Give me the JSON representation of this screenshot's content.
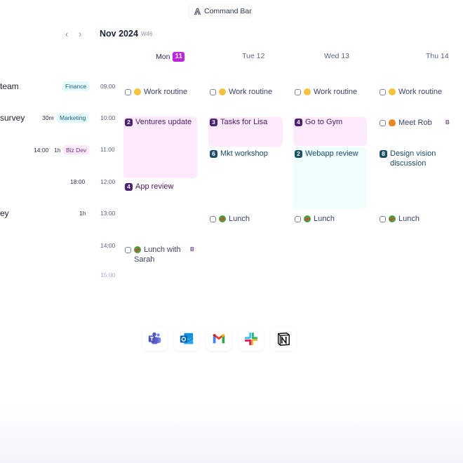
{
  "command_bar": {
    "label": "Command Bar",
    "icon": "command-icon"
  },
  "header": {
    "prev_icon": "chevron-left-icon",
    "next_icon": "chevron-right-icon",
    "prev_glyph": "‹",
    "next_glyph": "›",
    "month": "Nov 2024",
    "week": "W46",
    "days": [
      {
        "name": "Mon",
        "date": "11",
        "today": true,
        "label": "Mon"
      },
      {
        "label": "Tue 12"
      },
      {
        "label": "Wed 13"
      },
      {
        "label": "Thu 14"
      }
    ],
    "today_color": "#c122e0"
  },
  "task_list": [
    {
      "title": "team",
      "tag": "Finance"
    },
    {
      "title": "survey",
      "duration": "30m",
      "tag": "Marketing"
    },
    {
      "time": "14:00",
      "duration": "1h",
      "tag": "Biz Dev"
    },
    {
      "time": "18:00"
    },
    {
      "title": "ey",
      "duration": "1h"
    }
  ],
  "times": [
    "09:00",
    "10:00",
    "11:00",
    "12:00",
    "13:00",
    "14:00",
    "15:00"
  ],
  "events": {
    "mon": [
      {
        "title": "Work routine",
        "type": "checkable",
        "emoji": "slightly-smiling-face"
      },
      {
        "title": "Ventures update",
        "count": "2",
        "color": "purple"
      },
      {
        "title": "App review",
        "count": "4",
        "color": "purple"
      },
      {
        "title": "Lunch with",
        "title2": "Sarah",
        "type": "checkable",
        "emoji": "salad",
        "badge": "B"
      }
    ],
    "tue": [
      {
        "title": "Work routine",
        "type": "checkable",
        "emoji": "slightly-smiling-face"
      },
      {
        "title": "Tasks for Lisa",
        "count": "3",
        "color": "purple"
      },
      {
        "title": "Mkt workshop",
        "count": "6",
        "color": "teal"
      },
      {
        "title": "Lunch",
        "type": "checkable",
        "emoji": "salad"
      }
    ],
    "wed": [
      {
        "title": "Work routine",
        "type": "checkable",
        "emoji": "slightly-smiling-face"
      },
      {
        "title": "Go to Gym",
        "count": "4",
        "color": "purple"
      },
      {
        "title": "Webapp review",
        "count": "2",
        "color": "teal"
      },
      {
        "title": "Lunch",
        "type": "checkable",
        "emoji": "salad"
      }
    ],
    "thu": [
      {
        "title": "Work routine",
        "type": "checkable",
        "emoji": "slightly-smiling-face"
      },
      {
        "title": "Meet Rob",
        "type": "checkable",
        "emoji": "croissant",
        "badge": "B"
      },
      {
        "title": "Design vision",
        "title2": "discussion",
        "count": "8",
        "color": "teal"
      },
      {
        "title": "Lunch",
        "type": "checkable",
        "emoji": "salad"
      }
    ]
  },
  "integrations": [
    {
      "name": "Microsoft Teams",
      "icon": "teams-icon"
    },
    {
      "name": "Outlook",
      "icon": "outlook-icon"
    },
    {
      "name": "Gmail",
      "icon": "gmail-icon"
    },
    {
      "name": "Slack",
      "icon": "slack-icon"
    },
    {
      "name": "Notion",
      "icon": "notion-icon"
    }
  ]
}
